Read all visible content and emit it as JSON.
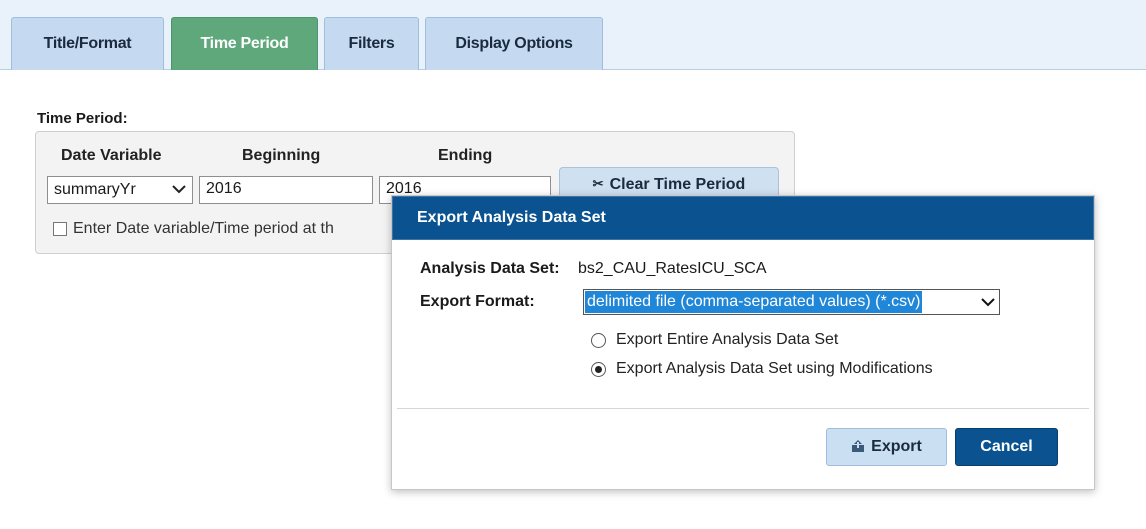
{
  "tabs": [
    {
      "label": "Title/Format"
    },
    {
      "label": "Time Period",
      "active": true
    },
    {
      "label": "Filters"
    },
    {
      "label": "Display Options"
    }
  ],
  "time_period": {
    "section_label": "Time Period:",
    "headers": {
      "date_variable": "Date Variable",
      "beginning": "Beginning",
      "ending": "Ending"
    },
    "date_variable_value": "summaryYr",
    "beginning_value": "2016",
    "ending_value": "2016",
    "clear_button_label": "Clear Time Period",
    "checkbox_label": "Enter Date variable/Time period at th"
  },
  "dialog": {
    "title": "Export Analysis Data Set",
    "analysis_data_set_label": "Analysis Data Set:",
    "analysis_data_set_value": "bs2_CAU_RatesICU_SCA",
    "export_format_label": "Export Format:",
    "export_format_value": "delimited file (comma-separated values) (*.csv)",
    "options": [
      {
        "label": "Export Entire Analysis Data Set",
        "selected": false
      },
      {
        "label": "Export Analysis Data Set using Modifications",
        "selected": true
      }
    ],
    "export_button": "Export",
    "cancel_button": "Cancel"
  },
  "icons": {
    "scissors": "scissors-icon",
    "export": "export-icon",
    "select_caret": "chevron-down-icon"
  },
  "colors": {
    "active_tab": "#5fa87b",
    "tab": "#c5daf0",
    "dialog_header": "#0b5390",
    "selected_option": "#1f86d8"
  }
}
